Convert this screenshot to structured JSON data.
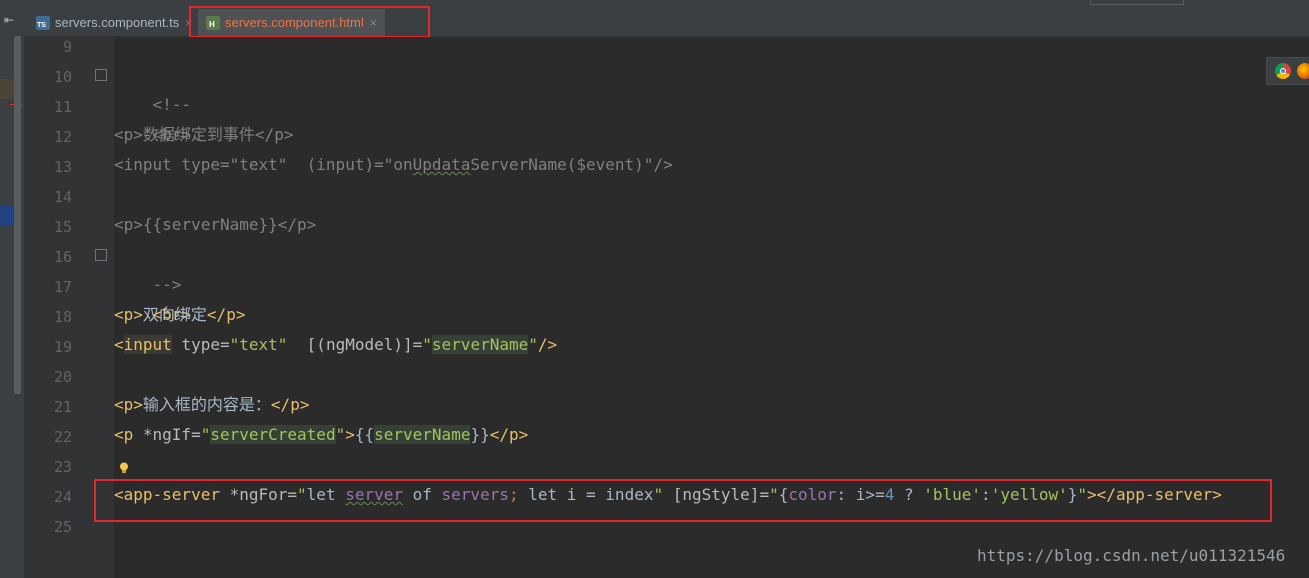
{
  "tabs": [
    {
      "label": "servers.component.ts",
      "icon": "typescript-file-icon",
      "active": false
    },
    {
      "label": "servers.component.html",
      "icon": "html-file-icon",
      "active": true
    }
  ],
  "close_glyph": "×",
  "line_numbers": [
    "9",
    "10",
    "11",
    "12",
    "13",
    "14",
    "15",
    "16",
    "17",
    "18",
    "19",
    "20",
    "21",
    "22",
    "23",
    "24",
    "25"
  ],
  "code": {
    "l10": "<!--",
    "l11": "<br>",
    "l12": {
      "open": "<p>",
      "text": "数据绑定到事件",
      "close": "</p>"
    },
    "l13": {
      "a": "<input type=",
      "b": "\"text\"",
      "c": "  (input)=",
      "d": "\"on",
      "e": "Updata",
      "f": "ServerName($event)\"",
      "g": "/>"
    },
    "l15": {
      "open": "<p>",
      "text": "{{serverName}}",
      "close": "</p>"
    },
    "l16": "-->",
    "l17": "<br>",
    "l18": {
      "open": "<p>",
      "text": "双向绑定",
      "close": "</p>"
    },
    "l19": {
      "lt": "<",
      "tag": "input",
      "attr": " type=",
      "str": "\"text\"",
      "attr2": "  [(ngModel)]=",
      "q1": "\"",
      "val": "serverName",
      "q2": "\"",
      "end": "/>"
    },
    "l21": {
      "open": "<p>",
      "text": "输入框的内容是：",
      "close": "</p>"
    },
    "l22": {
      "open": "<p",
      "attr": " *ngIf=",
      "q1": "\"",
      "val": "serverCreated",
      "q2": "\"",
      "gt": ">",
      "t1": "{{",
      "val2": "serverName",
      "t2": "}}",
      "close": "</p>"
    },
    "l24": {
      "open": "<app-server",
      "attr": " *ngFor=",
      "q1": "\"",
      "let1": "let ",
      "var1": "server",
      "of": " of ",
      "var2": "servers",
      "semi": "; ",
      "let2": "let ",
      "iexpr": "i = index",
      "q2": "\"",
      "attr2": " [ngStyle]=",
      "q3": "\"",
      "brace1": "{",
      "prop": "color",
      "colon": ": ",
      "cond": "i>=",
      "num": "4",
      "tern": " ? ",
      "s1": "'blue'",
      "colon2": ":",
      "s2": "'yellow'",
      "brace2": "}",
      "q4": "\"",
      "gt": ">",
      "close": "</app-server>"
    }
  },
  "watermark": "https://blog.csdn.net/u011321546",
  "colors": {
    "accent_red": "#e0282e",
    "active_tab_text": "#e8754a"
  }
}
